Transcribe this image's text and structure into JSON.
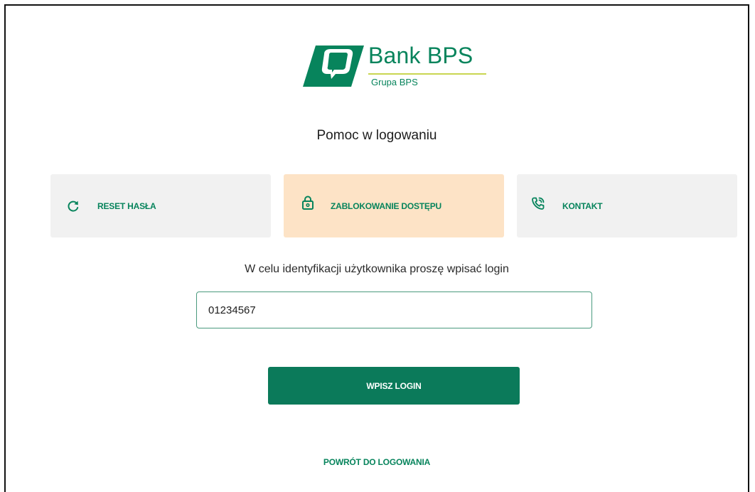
{
  "brand": {
    "name": "Bank BPS",
    "group": "Grupa BPS",
    "primary_color": "#07845c",
    "accent_color": "#c9d651",
    "logo_icon": "bank-bps-logo-icon"
  },
  "page": {
    "title": "Pomoc w logowaniu"
  },
  "options": [
    {
      "label": "RESET HASŁA",
      "icon": "refresh-icon",
      "active": false
    },
    {
      "label": "ZABLOKOWANIE DOSTĘPU",
      "icon": "lock-icon",
      "active": true
    },
    {
      "label": "KONTAKT",
      "icon": "phone-icon",
      "active": false
    }
  ],
  "form": {
    "instruction": "W celu identyfikacji użytkownika proszę wpisać login",
    "login_value": "01234567",
    "submit_label": "WPISZ LOGIN"
  },
  "footer": {
    "back_link": "POWRÓT DO LOGOWANIA"
  },
  "colors": {
    "active_tile_bg": "#fde3c6",
    "tile_bg": "#f1f1f1",
    "button_bg": "#0b7a5a"
  }
}
